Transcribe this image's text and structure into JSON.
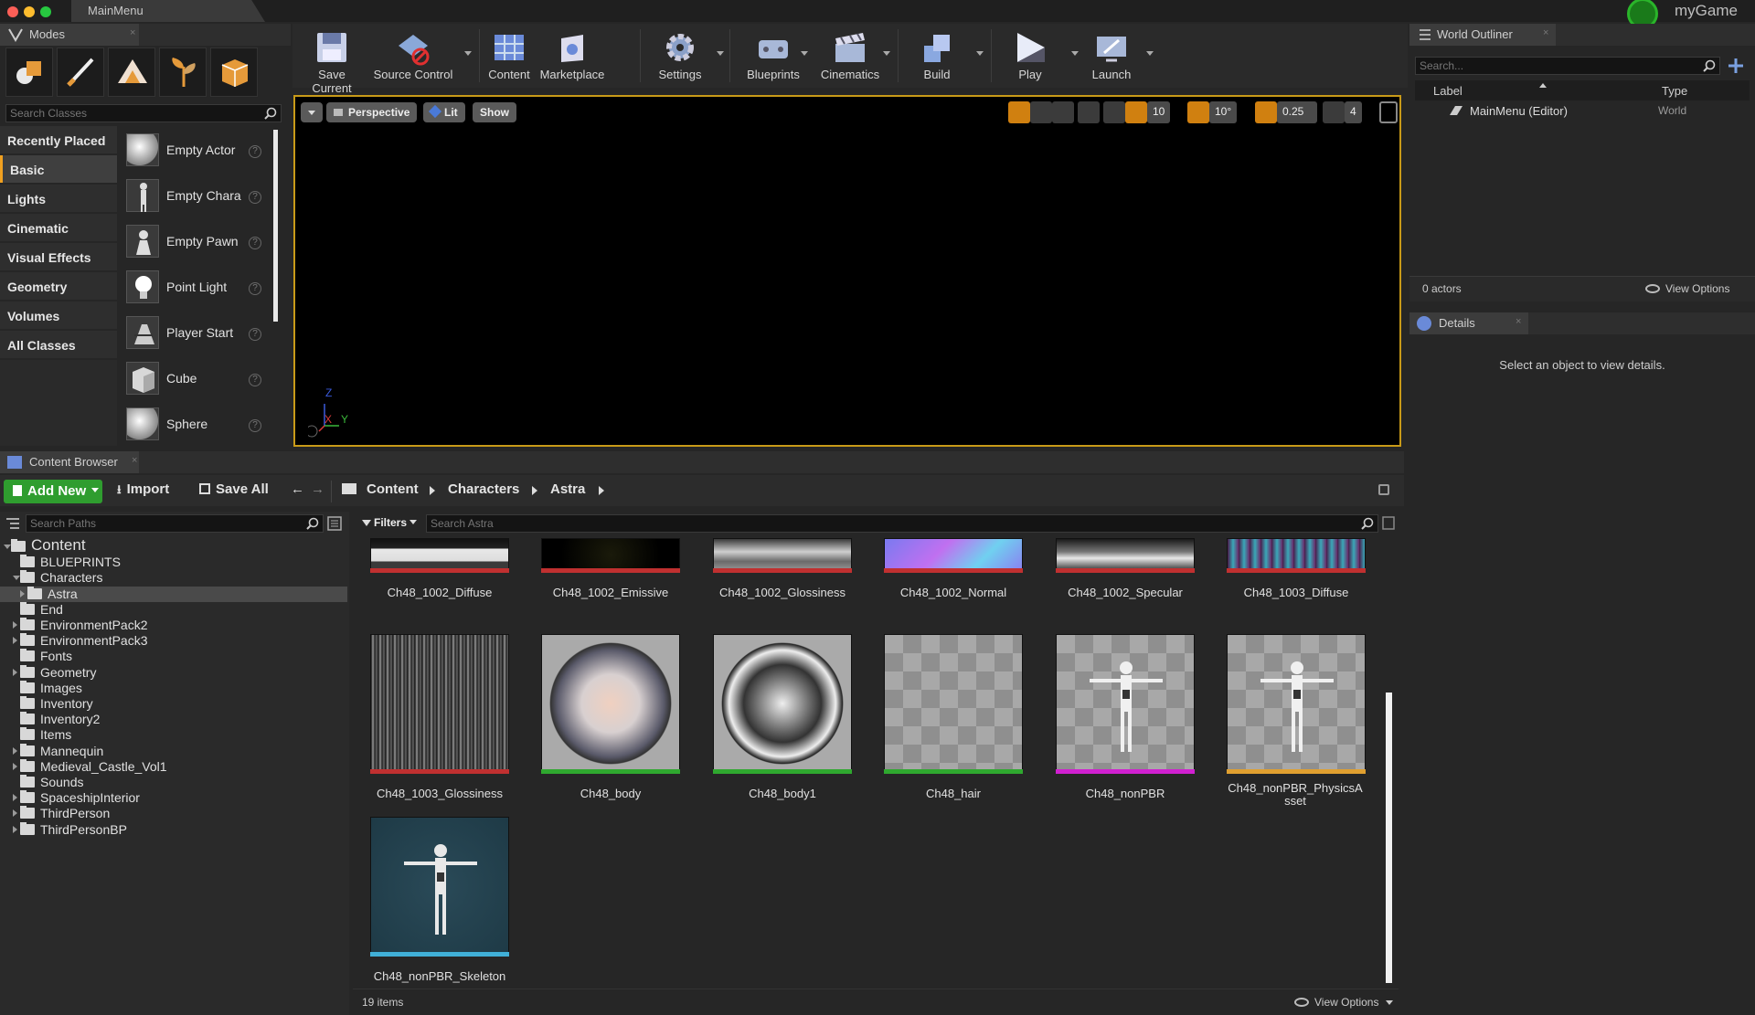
{
  "window": {
    "tab_title": "MainMenu",
    "brand": "myGame"
  },
  "modes": {
    "title": "Modes",
    "icons": [
      "place-mode-icon",
      "paint-mode-icon",
      "landscape-mode-icon",
      "foliage-mode-icon",
      "geometry-edit-mode-icon"
    ],
    "search_placeholder": "Search Classes",
    "categories": [
      "Recently Placed",
      "Basic",
      "Lights",
      "Cinematic",
      "Visual Effects",
      "Geometry",
      "Volumes",
      "All Classes"
    ],
    "selected_category": "Basic",
    "items": [
      "Empty Actor",
      "Empty Chara",
      "Empty Pawn",
      "Point Light",
      "Player Start",
      "Cube",
      "Sphere"
    ]
  },
  "toolbar": {
    "buttons": [
      {
        "label": "Save Current",
        "icon": "save-icon"
      },
      {
        "label": "Source Control",
        "icon": "source-control-icon"
      },
      {
        "label": "Content",
        "icon": "content-icon"
      },
      {
        "label": "Marketplace",
        "icon": "marketplace-icon"
      },
      {
        "label": "Settings",
        "icon": "settings-icon"
      },
      {
        "label": "Blueprints",
        "icon": "blueprints-icon"
      },
      {
        "label": "Cinematics",
        "icon": "cinematics-icon"
      },
      {
        "label": "Build",
        "icon": "build-icon"
      },
      {
        "label": "Play",
        "icon": "play-icon"
      },
      {
        "label": "Launch",
        "icon": "launch-icon"
      }
    ]
  },
  "viewport": {
    "perspective": "Perspective",
    "lit": "Lit",
    "show": "Show",
    "grid_snap": "10",
    "rotation_snap": "10°",
    "scale_snap": "0.25",
    "camera_speed": "4",
    "axis_z": "Z",
    "axis_x": "X",
    "axis_y": "Y"
  },
  "outliner": {
    "title": "World Outliner",
    "search_placeholder": "Search...",
    "col_label": "Label",
    "col_type": "Type",
    "rows": [
      {
        "label": "MainMenu (Editor)",
        "type": "World"
      }
    ],
    "actor_count": "0 actors",
    "view_options": "View Options"
  },
  "details": {
    "title": "Details",
    "empty_message": "Select an object to view details."
  },
  "content_browser": {
    "title": "Content Browser",
    "add_new": "Add New",
    "import": "Import",
    "save_all": "Save All",
    "breadcrumb": [
      "Content",
      "Characters",
      "Astra"
    ],
    "search_paths_placeholder": "Search Paths",
    "filters": "Filters",
    "search_assets_placeholder": "Search Astra",
    "tree": [
      {
        "name": "Content",
        "depth": 0,
        "expanded": true
      },
      {
        "name": "BLUEPRINTS",
        "depth": 1
      },
      {
        "name": "Characters",
        "depth": 1,
        "expanded": true
      },
      {
        "name": "Astra",
        "depth": 2,
        "selected": true
      },
      {
        "name": "End",
        "depth": 1
      },
      {
        "name": "EnvironmentPack2",
        "depth": 1
      },
      {
        "name": "EnvironmentPack3",
        "depth": 1
      },
      {
        "name": "Fonts",
        "depth": 1
      },
      {
        "name": "Geometry",
        "depth": 1
      },
      {
        "name": "Images",
        "depth": 1
      },
      {
        "name": "Inventory",
        "depth": 1
      },
      {
        "name": "Inventory2",
        "depth": 1
      },
      {
        "name": "Items",
        "depth": 1
      },
      {
        "name": "Mannequin",
        "depth": 1
      },
      {
        "name": "Medieval_Castle_Vol1",
        "depth": 1
      },
      {
        "name": "Sounds",
        "depth": 1
      },
      {
        "name": "SpaceshipInterior",
        "depth": 1
      },
      {
        "name": "ThirdPerson",
        "depth": 1
      },
      {
        "name": "ThirdPersonBP",
        "depth": 1
      }
    ],
    "assets": [
      {
        "name": "Ch48_1002_Diffuse",
        "color": "#c03030"
      },
      {
        "name": "Ch48_1002_Emissive",
        "color": "#c03030"
      },
      {
        "name": "Ch48_1002_Glossiness",
        "color": "#c03030"
      },
      {
        "name": "Ch48_1002_Normal",
        "color": "#c03030"
      },
      {
        "name": "Ch48_1002_Specular",
        "color": "#c03030"
      },
      {
        "name": "Ch48_1003_Diffuse",
        "color": "#c03030"
      },
      {
        "name": "Ch48_1003_Glossiness",
        "color": "#c03030"
      },
      {
        "name": "Ch48_body",
        "color": "#2fa82f"
      },
      {
        "name": "Ch48_body1",
        "color": "#2fa82f"
      },
      {
        "name": "Ch48_hair",
        "color": "#2fa82f"
      },
      {
        "name": "Ch48_nonPBR",
        "color": "#d020d0"
      },
      {
        "name": "Ch48_nonPBR_PhysicsAsset",
        "color": "#e0a030"
      },
      {
        "name": "Ch48_nonPBR_Skeleton",
        "color": "#40b0d8"
      }
    ],
    "item_count": "19 items",
    "view_options": "View Options"
  }
}
